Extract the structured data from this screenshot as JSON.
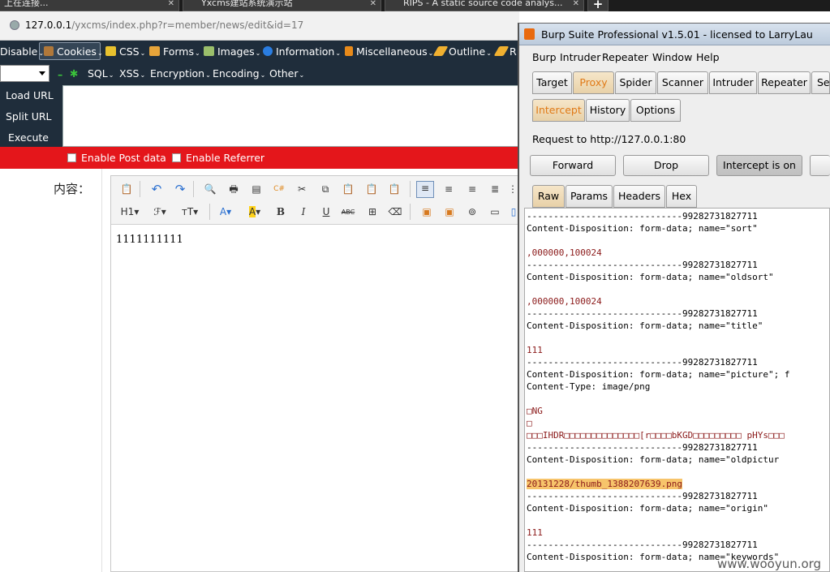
{
  "browser_tabs": [
    {
      "title": "上在连接..."
    },
    {
      "title": "Yxcms建站系统演示站"
    },
    {
      "title": "RIPS - A static source code analys..."
    }
  ],
  "address": {
    "host": "127.0.0.1",
    "path": "/yxcms/index.php?r=member/news/edit&id=17"
  },
  "hackbar": {
    "row1": [
      {
        "label": "Disable",
        "icon": "disable-icon",
        "color": "#ffffff"
      },
      {
        "label": "Cookies",
        "icon": "cookie-icon",
        "color": "#b0783a"
      },
      {
        "label": "CSS",
        "icon": "css-wand-icon",
        "color": "#e8c12e"
      },
      {
        "label": "Forms",
        "icon": "clipboard-icon",
        "color": "#e6a43a"
      },
      {
        "label": "Images",
        "icon": "image-icon",
        "color": "#9bbf6b"
      },
      {
        "label": "Information",
        "icon": "info-icon",
        "color": "#2a7de1"
      },
      {
        "label": "Miscellaneous",
        "icon": "misc-icon",
        "color": "#e88a1a"
      },
      {
        "label": "Outline",
        "icon": "pencil-icon",
        "color": "#f0b030"
      },
      {
        "label": "R",
        "icon": "pencil-icon",
        "color": "#f0b030"
      }
    ],
    "row2": [
      {
        "label": "SQL"
      },
      {
        "label": "XSS"
      },
      {
        "label": "Encryption"
      },
      {
        "label": "Encoding"
      },
      {
        "label": "Other"
      }
    ],
    "actions": [
      "Load URL",
      "Split URL",
      "Execute"
    ],
    "post_label": "Enable Post data",
    "referrer_label": "Enable Referrer"
  },
  "editor": {
    "label": "内容：",
    "text": "1111111111"
  },
  "burp": {
    "title": "Burp Suite Professional v1.5.01 - licensed to LarryLau",
    "menu": [
      "Burp",
      "Intruder",
      "Repeater",
      "Window",
      "Help"
    ],
    "tabs": [
      "Target",
      "Proxy",
      "Spider",
      "Scanner",
      "Intruder",
      "Repeater",
      "Se"
    ],
    "subtabs": [
      "Intercept",
      "History",
      "Options"
    ],
    "request_to": "Request to http://127.0.0.1:80",
    "buttons": {
      "forward": "Forward",
      "drop": "Drop",
      "intercept": "Intercept is on"
    },
    "viewtabs": [
      "Raw",
      "Params",
      "Headers",
      "Hex"
    ],
    "lines": [
      {
        "t": "-----------------------------99282731827711",
        "c": "n"
      },
      {
        "t": "Content-Disposition: form-data; name=\"sort\"",
        "c": "n"
      },
      {
        "t": "",
        "c": "n"
      },
      {
        "t": ",000000,100024",
        "c": "v"
      },
      {
        "t": "-----------------------------99282731827711",
        "c": "n"
      },
      {
        "t": "Content-Disposition: form-data; name=\"oldsort\"",
        "c": "n"
      },
      {
        "t": "",
        "c": "n"
      },
      {
        "t": ",000000,100024",
        "c": "v"
      },
      {
        "t": "-----------------------------99282731827711",
        "c": "n"
      },
      {
        "t": "Content-Disposition: form-data; name=\"title\"",
        "c": "n"
      },
      {
        "t": "",
        "c": "n"
      },
      {
        "t": "111",
        "c": "v"
      },
      {
        "t": "-----------------------------99282731827711",
        "c": "n"
      },
      {
        "t": "Content-Disposition: form-data; name=\"picture\"; f",
        "c": "n"
      },
      {
        "t": "Content-Type: image/png",
        "c": "n"
      },
      {
        "t": "",
        "c": "n"
      },
      {
        "t": "□NG",
        "c": "v"
      },
      {
        "t": "□",
        "c": "v"
      },
      {
        "t": "□□□IHDR□□□□□□□□□□□□□□[r□□□□bKGD□□□□□□□□□ pHYs□□□",
        "c": "v"
      },
      {
        "t": "-----------------------------99282731827711",
        "c": "n"
      },
      {
        "t": "Content-Disposition: form-data; name=\"oldpictur",
        "c": "n"
      },
      {
        "t": "",
        "c": "n"
      },
      {
        "t": "20131228/thumb_1388207639.png",
        "c": "hl"
      },
      {
        "t": "-----------------------------99282731827711",
        "c": "n"
      },
      {
        "t": "Content-Disposition: form-data; name=\"origin\"",
        "c": "n"
      },
      {
        "t": "",
        "c": "n"
      },
      {
        "t": "111",
        "c": "v"
      },
      {
        "t": "-----------------------------99282731827711",
        "c": "n"
      },
      {
        "t": "Content-Disposition: form-data; name=\"keywords\"",
        "c": "n"
      }
    ]
  },
  "watermark": "www.wooyun.org"
}
